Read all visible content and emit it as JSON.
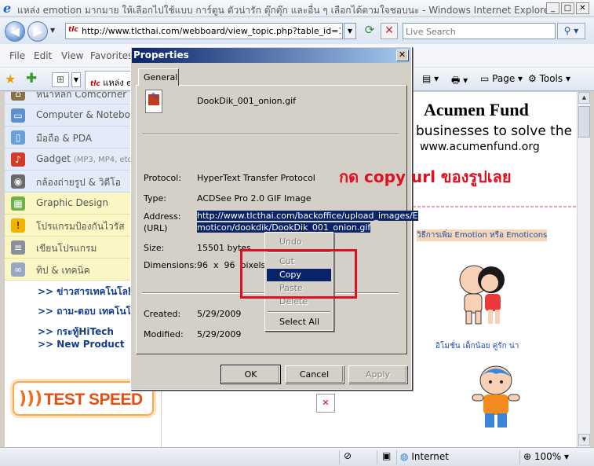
{
  "window": {
    "title": "แหล่ง emotion มากมาย ให้เลือกไปใช้แบบ การ์ตูน ตัวน่ารัก ตุ๊กตุ๊ก และอื่น ๆ เลือกได้ตามใจชอบนะ - Windows Internet Explorer",
    "minimize": "_",
    "maximize": "□",
    "close": "✕"
  },
  "addressbar": {
    "back": "◀",
    "forward": "▶",
    "url": "http://www.tlcthai.com/webboard/view_topic.php?table_id=1&cate_",
    "favicon": "tlc",
    "refresh": "⟳",
    "stop": "✕",
    "search_placeholder": "Live Search",
    "search_button": "⚲ ▾"
  },
  "menubar": {
    "items": [
      "File",
      "Edit",
      "View",
      "Favorites"
    ]
  },
  "favbar": {
    "tab_label": "แหล่ง e",
    "tools": [
      "Page",
      "Tools"
    ]
  },
  "sidebar": {
    "categories": [
      {
        "label": "หน้าหลัก Comcorner",
        "icon": "home-icon"
      },
      {
        "label": "Computer & Notebook",
        "icon": "computer-icon"
      },
      {
        "label": "มือถือ & PDA",
        "icon": "mobile-icon"
      },
      {
        "label": "Gadget",
        "sub": "(MP3, MP4, etc",
        "icon": "gadget-icon"
      },
      {
        "label": "กล้องถ่ายรูป & วิดีโอ",
        "icon": "camera-icon"
      },
      {
        "label": "Graphic Design",
        "icon": "graphic-icon"
      },
      {
        "label": "โปรแกรมป้องกันไวรัส",
        "icon": "warning-icon"
      },
      {
        "label": "เขียนโปรแกรม",
        "icon": "code-icon"
      },
      {
        "label": "ทิป & เทคนิค",
        "icon": "tips-icon"
      }
    ],
    "links": [
      ">> ข่าวสารเทคโนโลยี",
      ">> ถาม-ตอบ เทคโนโลยี",
      ">> กระทู้HiTech",
      ">> New Product"
    ],
    "banner": "TEST SPEED"
  },
  "content": {
    "title": "Acumen Fund",
    "subtitle": "businesses to solve the pr",
    "site": "www.acumenfund.org",
    "emo_link": "วิธีการเพิ่ม Emotion หรือ Emoticons",
    "caption": "อิโมชั่น เด็กน้อย คู่รัก น่า",
    "broken_image": "✕"
  },
  "dialog": {
    "title": "Properties",
    "close": "✕",
    "tab": "General",
    "filename": "DookDik_001_onion.gif",
    "protocol_label": "Protocol:",
    "protocol": "HyperText Transfer Protocol",
    "type_label": "Type:",
    "type": "ACDSee Pro 2.0 GIF Image",
    "address_label": "Address:",
    "url_label": "(URL)",
    "address_line1": "http://www.tlcthai.com/backoffice/upload_images/E",
    "address_line2": "moticon/dookdik/DookDik_001_onion.gif",
    "size_label": "Size:",
    "size": "15501 bytes",
    "dimensions_label": "Dimensions:",
    "dimensions": "96  x  96  pixels",
    "created_label": "Created:",
    "created": "5/29/2009",
    "modified_label": "Modified:",
    "modified": "5/29/2009",
    "buttons": {
      "ok": "OK",
      "cancel": "Cancel",
      "apply": "Apply"
    }
  },
  "context_menu": {
    "undo": "Undo",
    "cut": "Cut",
    "copy": "Copy",
    "paste": "Paste",
    "delete": "Delete",
    "select_all": "Select All"
  },
  "annotation": {
    "note": "กด copy url ของรูปเลย",
    "color": "#e01020"
  },
  "statusbar": {
    "zone": "Internet",
    "zoom": "100%"
  }
}
